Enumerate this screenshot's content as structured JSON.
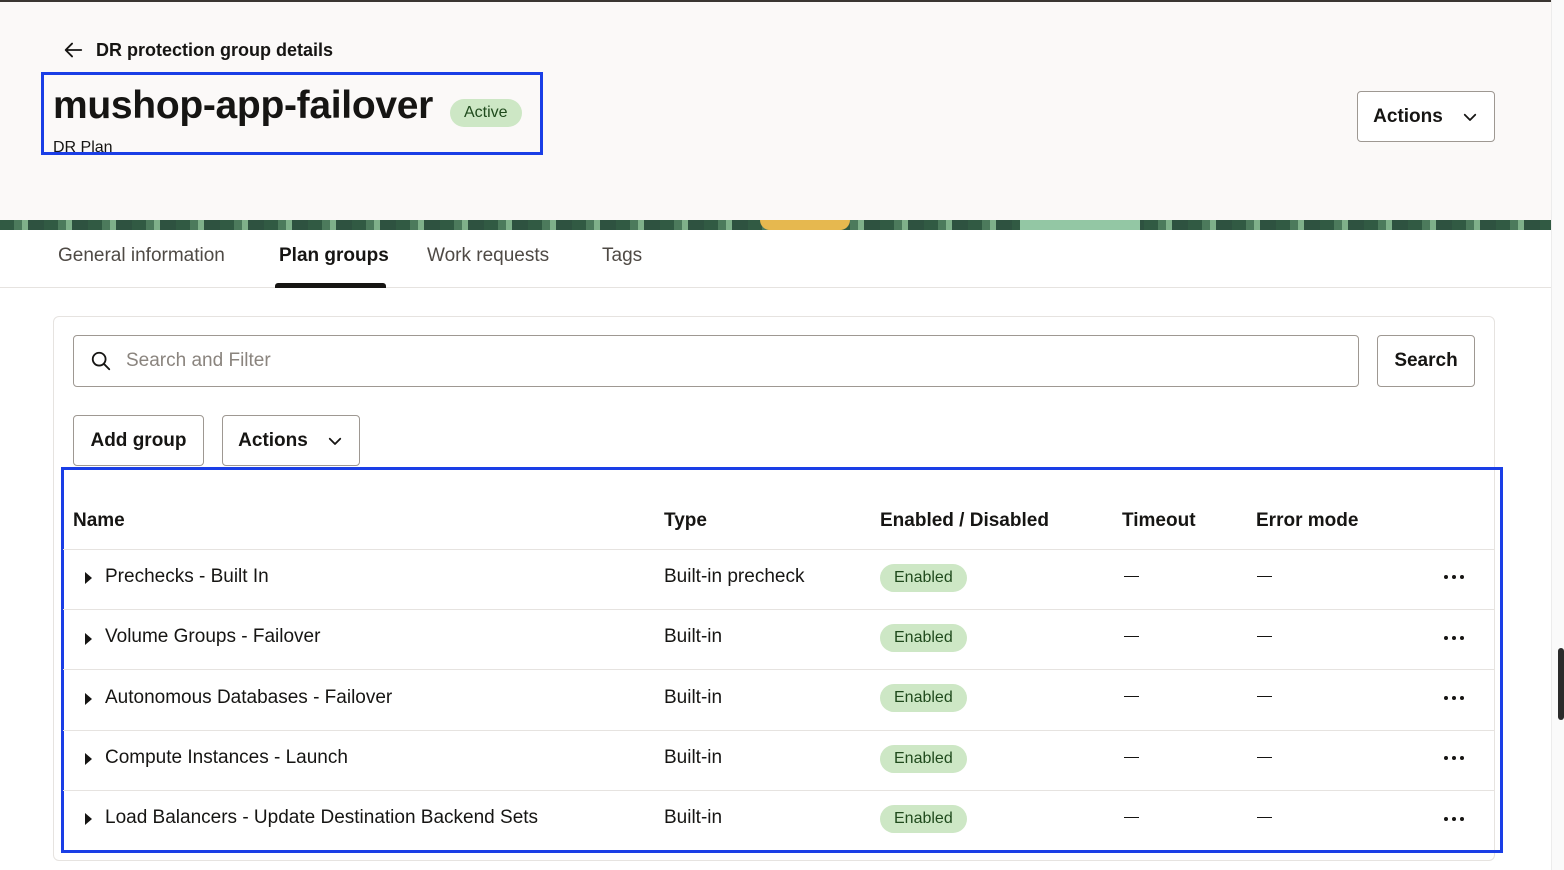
{
  "header": {
    "back_label": "DR protection group details",
    "title": "mushop-app-failover",
    "status": "Active",
    "subtitle": "DR Plan",
    "actions_label": "Actions"
  },
  "tabs": [
    {
      "label": "General information",
      "active": false
    },
    {
      "label": "Plan groups",
      "active": true
    },
    {
      "label": "Work requests",
      "active": false
    },
    {
      "label": "Tags",
      "active": false
    }
  ],
  "search": {
    "placeholder": "Search and Filter",
    "button_label": "Search"
  },
  "toolbar": {
    "add_group_label": "Add group",
    "actions_label": "Actions"
  },
  "table": {
    "columns": [
      "Name",
      "Type",
      "Enabled / Disabled",
      "Timeout",
      "Error mode"
    ],
    "rows": [
      {
        "name": "Prechecks - Built In",
        "type": "Built-in precheck",
        "enabled": "Enabled"
      },
      {
        "name": "Volume Groups - Failover",
        "type": "Built-in",
        "enabled": "Enabled"
      },
      {
        "name": "Autonomous Databases - Failover",
        "type": "Built-in",
        "enabled": "Enabled"
      },
      {
        "name": "Compute Instances - Launch",
        "type": "Built-in",
        "enabled": "Enabled"
      },
      {
        "name": "Load Balancers - Update Destination Backend Sets",
        "type": "Built-in",
        "enabled": "Enabled"
      }
    ]
  },
  "colors": {
    "highlight": "#1a3ee6",
    "status_green_bg": "#cde7c5",
    "header_bg": "#fbf9f8"
  },
  "icons": {
    "back": "arrow-left-icon",
    "dropdown": "chevron-down-icon",
    "search": "search-icon",
    "row_expand": "caret-right-icon",
    "row_menu": "more-horizontal-icon"
  }
}
